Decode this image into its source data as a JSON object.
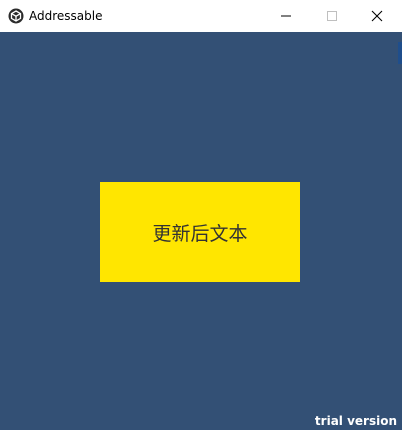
{
  "window": {
    "title": "Addressable",
    "background_color": "#335075"
  },
  "titlebar": {
    "icon": "unity-logo-icon",
    "minimize_icon": "minimize-icon",
    "maximize_icon": "maximize-icon",
    "close_icon": "close-icon"
  },
  "content": {
    "button_label": "更新后文本",
    "button_color": "#ffe600"
  },
  "watermark": {
    "text": "trial version"
  }
}
